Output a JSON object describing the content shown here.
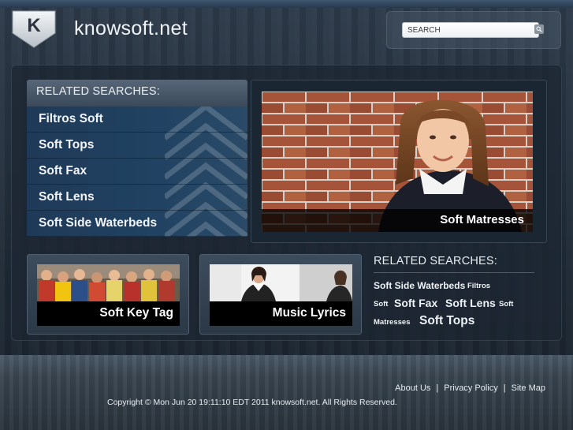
{
  "header": {
    "logo_letter": "K",
    "site_name": "knowsoft.net",
    "search": {
      "placeholder": "SEARCH",
      "icon": "search-icon"
    }
  },
  "related_left": {
    "title": "RELATED SEARCHES:",
    "items": [
      {
        "label": "Filtros Soft"
      },
      {
        "label": "Soft Tops"
      },
      {
        "label": "Soft Fax"
      },
      {
        "label": "Soft Lens"
      },
      {
        "label": "Soft Side Waterbeds"
      }
    ]
  },
  "hero": {
    "caption": "Soft Matresses"
  },
  "thumbs": [
    {
      "caption": "Soft Key Tag"
    },
    {
      "caption": "Music Lyrics"
    }
  ],
  "related_right": {
    "title": "RELATED SEARCHES:",
    "tags": [
      {
        "label": "Soft Side Waterbeds",
        "weight": "medium"
      },
      {
        "label": "Filtros",
        "weight": "small"
      },
      {
        "label": "Soft",
        "weight": "small"
      },
      {
        "label": "Soft Fax",
        "weight": "large"
      },
      {
        "label": "Soft Lens",
        "weight": "large"
      },
      {
        "label": "Soft",
        "weight": "small"
      },
      {
        "label": "Matresses",
        "weight": "small"
      },
      {
        "label": "Soft Tops",
        "weight": "xlarge"
      }
    ]
  },
  "footer": {
    "links": [
      {
        "label": "About Us"
      },
      {
        "label": "Privacy Policy"
      },
      {
        "label": "Site Map"
      }
    ],
    "separator": "|",
    "copyright": "Copyright © Mon Jun 20 19:11:10 EDT 2011 knowsoft.net. All Rights Reserved."
  },
  "colors": {
    "background": "#1c2530",
    "panel_blue": "#214262",
    "accent_white": "#ffffff"
  }
}
